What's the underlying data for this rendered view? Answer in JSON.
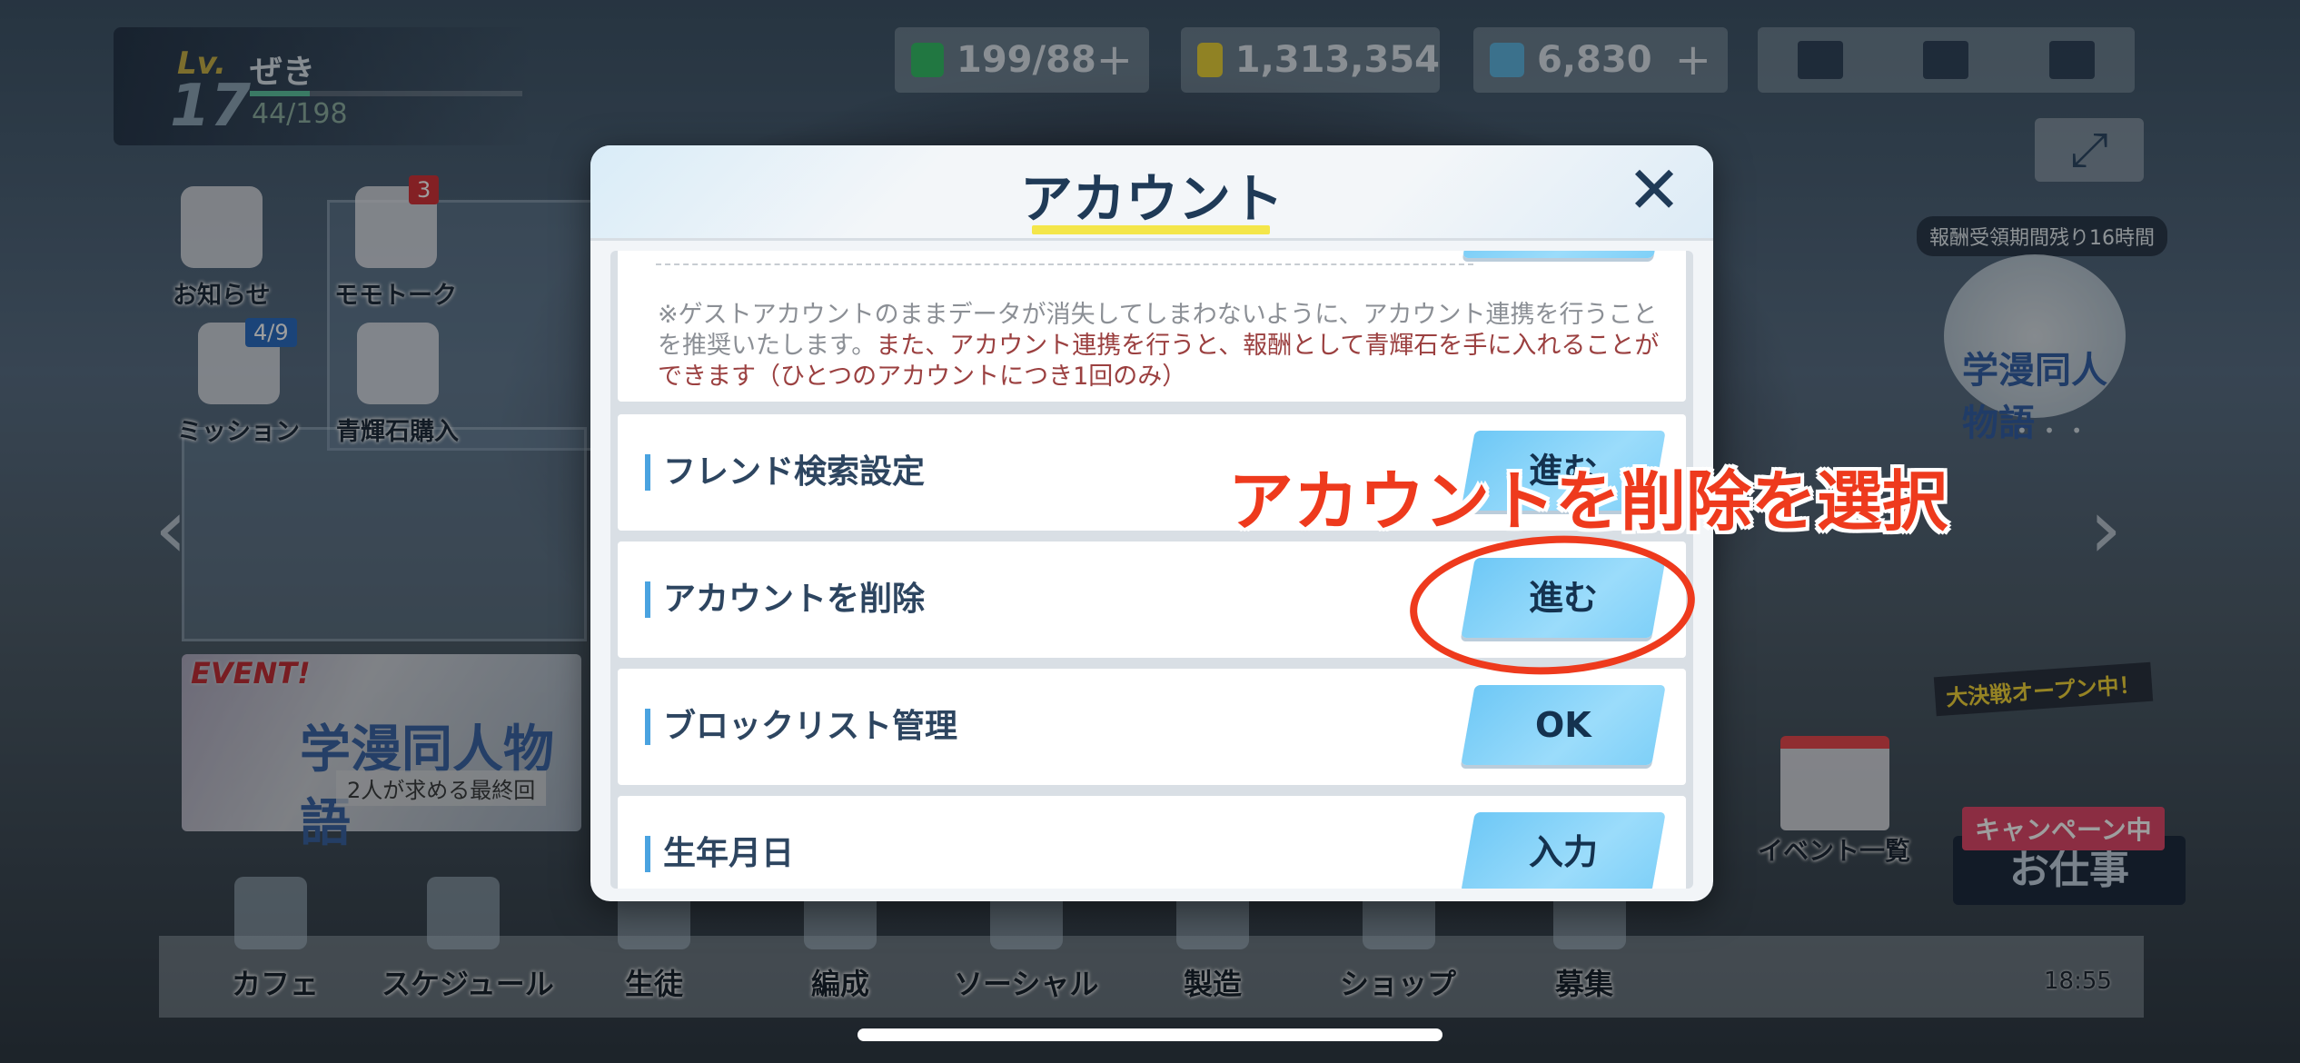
{
  "player": {
    "lv_label": "Lv.",
    "level": "17",
    "name": "ぜき",
    "exp": "44/198"
  },
  "currencies": {
    "stamina": "199/88",
    "credits": "1,313,354",
    "pyroxene": "6,830",
    "plus": "+"
  },
  "expand_icon": "⤢",
  "shortcuts": {
    "news": "お知らせ",
    "momotalk": "モモトーク",
    "momotalk_badge": "3",
    "mission": "ミッション",
    "mission_badge": "4/9",
    "shop_pyroxene": "青輝石購入"
  },
  "event_banner": {
    "tag": "EVENT!",
    "title": "学漫同人物語",
    "subtitle": "2人が求める最終回"
  },
  "right_panel": {
    "timer": "報酬受領期間残り16時間",
    "banner_title": "学漫同人物語",
    "dots": "• • •",
    "event_list": "イベント一覧",
    "taiketsu": "大決戦オープン中！",
    "campaign": "キャンペーン中",
    "job": "お仕事"
  },
  "bottom_nav": [
    "カフェ",
    "スケジュール",
    "生徒",
    "編成",
    "ソーシャル",
    "製造",
    "ショップ",
    "募集"
  ],
  "clock": "18:55",
  "modal": {
    "title": "アカウント",
    "close_icon": "✕",
    "note_gray": "※ゲストアカウントのままデータが消失してしまわないように、アカウント連携を行うことを推奨いたします。",
    "note_red": "また、アカウント連携を行うと、報酬として青輝石を手に入れることができます（ひとつのアカウントにつき1回のみ）",
    "rows": [
      {
        "label": "フレンド検索設定",
        "button": "進む"
      },
      {
        "label": "アカウントを削除",
        "button": "進む"
      },
      {
        "label": "ブロックリスト管理",
        "button": "OK"
      },
      {
        "label": "生年月日",
        "button": "入力"
      }
    ]
  },
  "annotation": {
    "callout": "アカウントを削除を選択"
  },
  "colors": {
    "accent": "#4aa3e0",
    "callout": "#ee3a1d",
    "underline": "#f4e64a",
    "button": "#7fd0f8"
  }
}
